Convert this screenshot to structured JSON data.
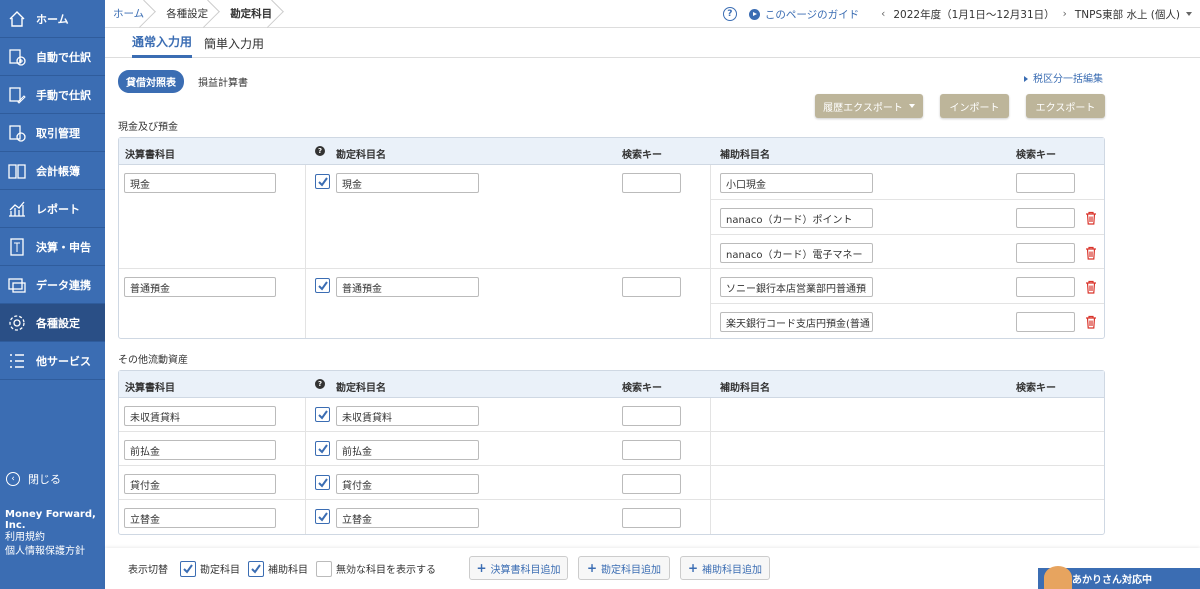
{
  "sidebar": {
    "items": [
      {
        "label": "ホーム",
        "icon": "home-icon"
      },
      {
        "label": "自動で仕訳",
        "icon": "auto-journal-icon"
      },
      {
        "label": "手動で仕訳",
        "icon": "manual-journal-icon"
      },
      {
        "label": "取引管理",
        "icon": "transaction-icon"
      },
      {
        "label": "会計帳簿",
        "icon": "ledger-icon"
      },
      {
        "label": "レポート",
        "icon": "report-chart-icon"
      },
      {
        "label": "決算・申告",
        "icon": "filing-icon"
      },
      {
        "label": "データ連携",
        "icon": "data-link-icon"
      },
      {
        "label": "各種設定",
        "icon": "gear-icon"
      },
      {
        "label": "他サービス",
        "icon": "list-icon"
      }
    ],
    "close_label": "閉じる",
    "company": "Money Forward, Inc.",
    "terms": "利用規約",
    "privacy": "個人情報保護方針"
  },
  "breadcrumb": {
    "home": "ホーム",
    "settings": "各種設定",
    "current": "勘定科目"
  },
  "header": {
    "help": "?",
    "guide": "このページのガイド",
    "fiscal_year": "2022年度（1月1日〜12月31日）",
    "user": "TNPS東部 水上 (個人)"
  },
  "tabs": {
    "normal": "通常入力用",
    "simple": "簡単入力用"
  },
  "subtabs": {
    "bs": "貸借対照表",
    "pl": "損益計算書"
  },
  "tax_link": "税区分一括編集",
  "actions": {
    "history_export": "履歴エクスポート",
    "import": "インポート",
    "export": "エクスポート"
  },
  "columns": {
    "statement_item": "決算書科目",
    "help_q": "?",
    "account_name": "勘定科目名",
    "search_key": "検索キー",
    "sub_account_name": "補助科目名",
    "sub_search_key": "検索キー"
  },
  "sections": [
    {
      "title": "現金及び預金",
      "groups": [
        {
          "statement": "現金",
          "account": "現金",
          "search_key": "",
          "subs": [
            {
              "name": "小口現金",
              "key": "",
              "deletable": false
            },
            {
              "name": "nanaco（カード）ポイント",
              "key": "",
              "deletable": true
            },
            {
              "name": "nanaco（カード）電子マネー",
              "key": "",
              "deletable": true
            }
          ]
        },
        {
          "statement": "普通預金",
          "account": "普通預金",
          "search_key": "",
          "subs": [
            {
              "name": "ソニー銀行本店営業部円普通預",
              "key": "",
              "deletable": true
            },
            {
              "name": "楽天銀行コード支店円預金(普通",
              "key": "",
              "deletable": true
            }
          ]
        }
      ]
    },
    {
      "title": "その他流動資産",
      "groups": [
        {
          "statement": "未収賃貸料",
          "account": "未収賃貸料",
          "search_key": "",
          "subs": []
        },
        {
          "statement": "前払金",
          "account": "前払金",
          "search_key": "",
          "subs": []
        },
        {
          "statement": "貸付金",
          "account": "貸付金",
          "search_key": "",
          "subs": []
        },
        {
          "statement": "立替金",
          "account": "立替金",
          "search_key": "",
          "subs": []
        }
      ]
    }
  ],
  "footer": {
    "toggle_label": "表示切替",
    "show_accounts": "勘定科目",
    "show_subs": "補助科目",
    "show_invalid": "無効な科目を表示する",
    "add_statement": "決算書科目追加",
    "add_account": "勘定科目追加",
    "add_sub": "補助科目追加"
  },
  "chat": "あかりさん対応中",
  "colors": {
    "brand": "#3b6db3",
    "sidebar_active": "#2a4f86",
    "action_button": "#bdb59a",
    "delete": "#d9342b"
  }
}
